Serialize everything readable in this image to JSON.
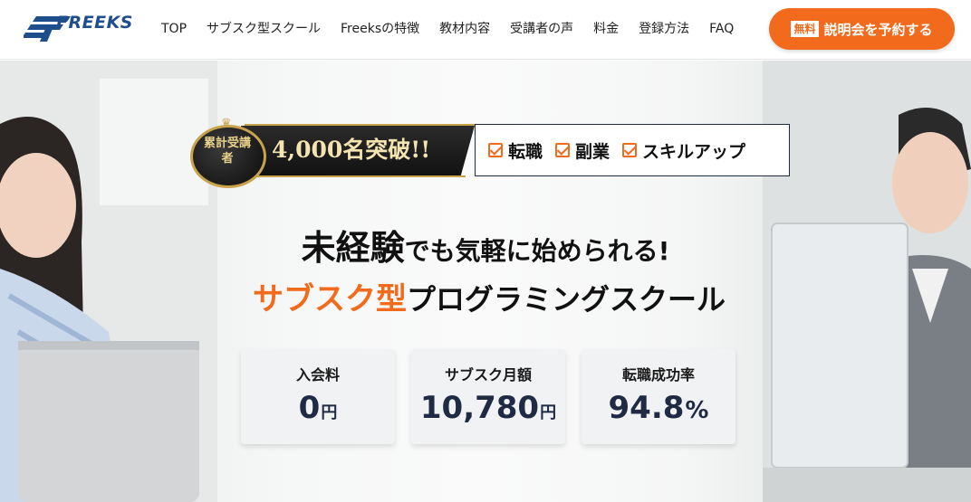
{
  "header": {
    "logo_text": "FREEKS",
    "nav": [
      "TOP",
      "サブスク型スクール",
      "Freeksの特徴",
      "教材内容",
      "受講者の声",
      "料金",
      "登録方法",
      "FAQ"
    ],
    "cta": {
      "tag": "無料",
      "label": "説明会を予約する"
    }
  },
  "hero": {
    "medal_text": "累計受講者",
    "count": "4,000名突破!!",
    "checks": [
      "転職",
      "副業",
      "スキルアップ"
    ],
    "headline_1": {
      "big": "未経験",
      "rest": "でも気軽に始められる!"
    },
    "headline_2": {
      "accent": "サブスク型",
      "rest": "プログラミングスクール"
    },
    "cards": [
      {
        "title": "入会料",
        "value": "0",
        "unit": "円"
      },
      {
        "title": "サブスク月額",
        "value": "10,780",
        "unit": "円"
      },
      {
        "title": "転職成功率",
        "value": "94.8",
        "unit": "%"
      }
    ]
  },
  "colors": {
    "accent": "#f26a1b",
    "navy": "#1f2a44",
    "brand_blue": "#1f4e8c",
    "gold": "#c9a24c"
  }
}
